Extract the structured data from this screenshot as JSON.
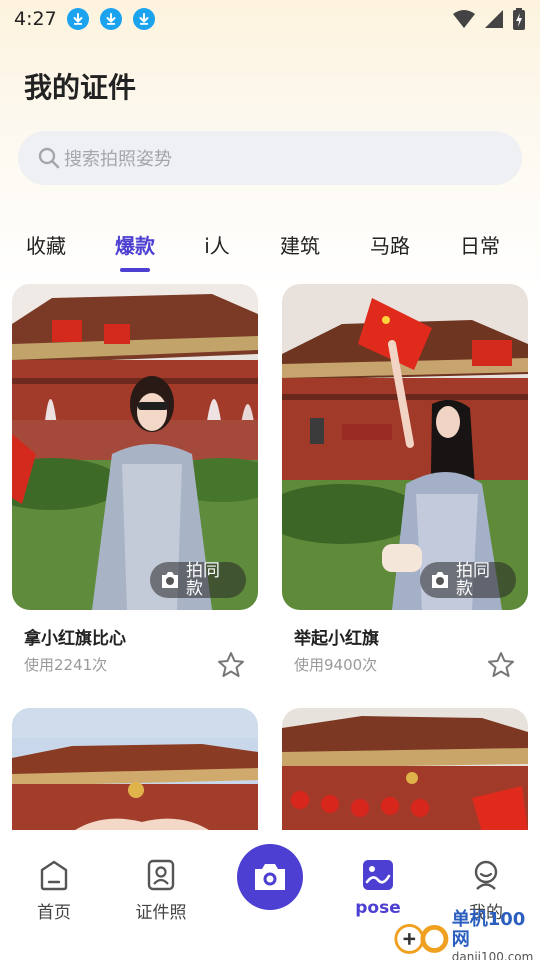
{
  "status_bar": {
    "time": "4:27",
    "download_icons": [
      "download-icon",
      "download-icon",
      "download-icon"
    ],
    "right_icons": [
      "wifi-icon",
      "signal-icon",
      "battery-charging-icon"
    ]
  },
  "header": {
    "title": "我的证件"
  },
  "search": {
    "placeholder": "搜索拍照姿势",
    "icon": "search-icon"
  },
  "tabs": [
    {
      "label": "收藏",
      "active": false
    },
    {
      "label": "爆款",
      "active": true
    },
    {
      "label": "i人",
      "active": false
    },
    {
      "label": "建筑",
      "active": false
    },
    {
      "label": "马路",
      "active": false
    },
    {
      "label": "日常",
      "active": false
    }
  ],
  "cards": [
    {
      "title": "拿小红旗比心",
      "uses": "使用2241次",
      "button_label": "拍同款",
      "favorite": false
    },
    {
      "title": "举起小红旗",
      "uses": "使用9400次",
      "button_label": "拍同款",
      "favorite": false
    }
  ],
  "bottom_nav": {
    "items": [
      {
        "label": "首页",
        "icon": "home-icon",
        "active": false
      },
      {
        "label": "证件照",
        "icon": "id-photo-icon",
        "active": false
      },
      {
        "label": "",
        "icon": "camera-icon",
        "active": false
      },
      {
        "label": "pose",
        "icon": "pose-icon",
        "active": true
      },
      {
        "label": "我的",
        "icon": "profile-icon",
        "active": false
      }
    ]
  },
  "watermark": {
    "text": "单机100网",
    "url": "danji100.com"
  },
  "colors": {
    "accent": "#4d3fd1",
    "download_badge": "#1ba3f0",
    "search_bg": "#eff0f3"
  }
}
